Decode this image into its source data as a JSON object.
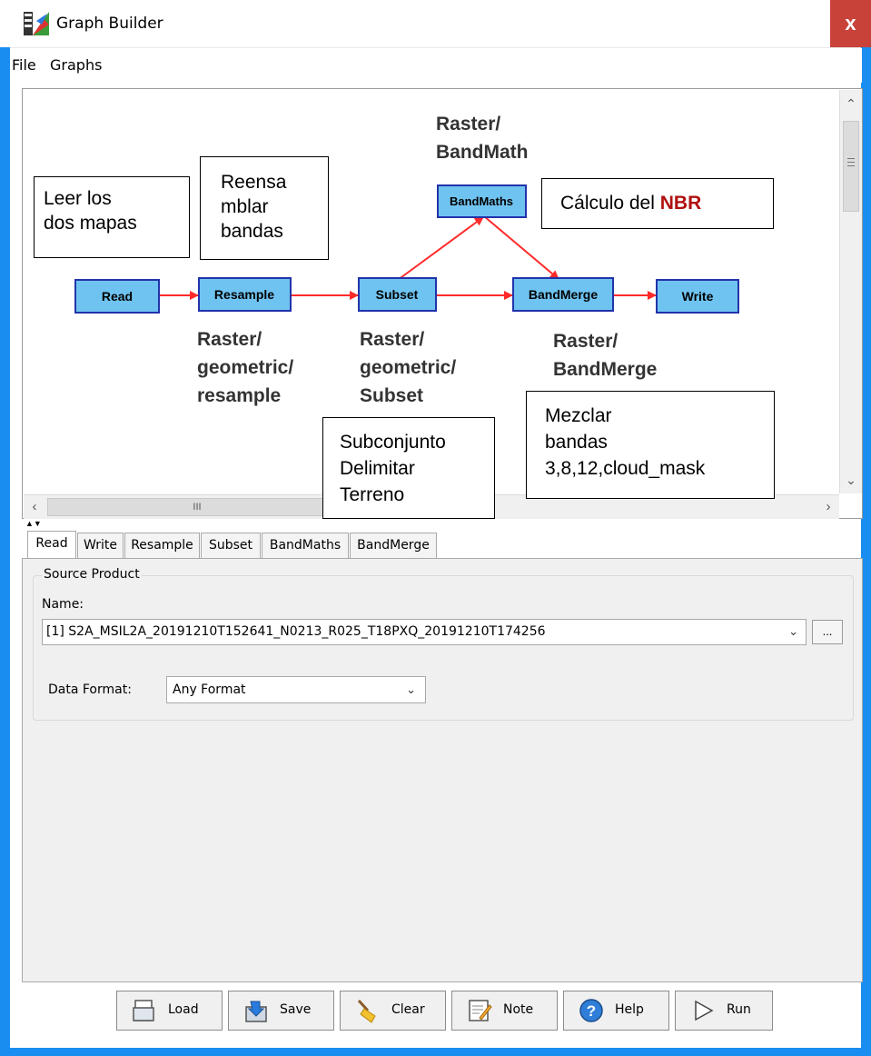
{
  "window": {
    "title": "Graph Builder",
    "close_label": "x"
  },
  "menu": {
    "items": [
      "File",
      "Graphs"
    ]
  },
  "graph": {
    "nodes": {
      "read": "Read",
      "resample": "Resample",
      "subset": "Subset",
      "bandmaths": "BandMaths",
      "bandmerge": "BandMerge",
      "write": "Write"
    }
  },
  "annotations": {
    "read_note": [
      "Leer los",
      "dos mapas"
    ],
    "resample_note": [
      "Reensa",
      "mblar",
      "bandas"
    ],
    "bandmath_path": [
      "Raster/",
      "BandMath"
    ],
    "nbr_note_prefix": "Cálculo del ",
    "nbr_note_highlight": "NBR",
    "resample_path": [
      "Raster/",
      "geometric/",
      "resample"
    ],
    "subset_path": [
      "Raster/",
      "geometric/",
      "Subset"
    ],
    "bandmerge_path": [
      "Raster/",
      "BandMerge"
    ],
    "subset_note": [
      "Subconjunto",
      "Delimitar",
      "Terreno"
    ],
    "bandmerge_note": [
      "Mezclar",
      "bandas",
      "3,8,12,cloud_mask"
    ]
  },
  "tabs": [
    "Read",
    "Write",
    "Resample",
    "Subset",
    "BandMaths",
    "BandMerge"
  ],
  "read_panel": {
    "group_title": "Source Product",
    "name_label": "Name:",
    "name_value": "[1] S2A_MSIL2A_20191210T152641_N0213_R025_T18PXQ_20191210T174256",
    "browse_label": "...",
    "format_label": "Data Format:",
    "format_value": "Any Format"
  },
  "buttons": {
    "load": "Load",
    "save": "Save",
    "clear": "Clear",
    "note": "Note",
    "help": "Help",
    "run": "Run"
  },
  "scrollbar": {
    "grip": "III"
  },
  "colors": {
    "node_fill": "#6fc3f0",
    "node_border": "#2233aa",
    "edge": "#ff2a2a",
    "nbr_highlight": "#b01010",
    "window_border": "#1a8ef0"
  }
}
